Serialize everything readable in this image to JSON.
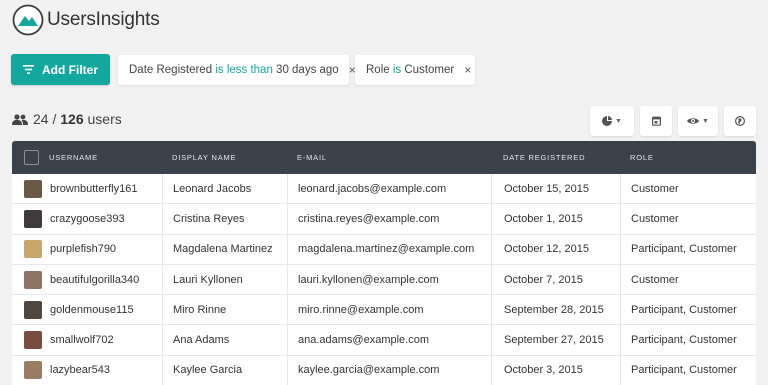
{
  "brand": {
    "name": "UsersInsights",
    "colors": {
      "accent": "#14a79d",
      "header": "#3b424b"
    }
  },
  "toolbar": {
    "add_filter_label": "Add Filter"
  },
  "filters": [
    {
      "field": "Date Registered",
      "operator": "is less than",
      "value": "30 days ago"
    },
    {
      "field": "Role",
      "operator": "is",
      "value": "Customer"
    }
  ],
  "filter_remove_glyph": "×",
  "summary": {
    "filtered": "24",
    "separator": " / ",
    "total": "126",
    "unit": " users"
  },
  "view_buttons": [
    {
      "icon": "pie-chart-icon",
      "has_dropdown": true
    },
    {
      "icon": "calendar-icon",
      "has_dropdown": false
    },
    {
      "icon": "eye-icon",
      "has_dropdown": true
    },
    {
      "icon": "globe-icon",
      "has_dropdown": false
    }
  ],
  "table": {
    "columns": [
      "Username",
      "Display Name",
      "E-mail",
      "Date Registered",
      "Role"
    ],
    "rows": [
      {
        "username": "brownbutterfly161",
        "display_name": "Leonard Jacobs",
        "email": "leonard.jacobs@example.com",
        "date": "October 15, 2015",
        "role": "Customer",
        "avatar_color": "#6b5845"
      },
      {
        "username": "crazygoose393",
        "display_name": "Cristina Reyes",
        "email": "cristina.reyes@example.com",
        "date": "October 1, 2015",
        "role": "Customer",
        "avatar_color": "#3d3a39"
      },
      {
        "username": "purplefish790",
        "display_name": "Magdalena Martinez",
        "email": "magdalena.martinez@example.com",
        "date": "October 12, 2015",
        "role": "Participant, Customer",
        "avatar_color": "#c9a66b"
      },
      {
        "username": "beautifulgorilla340",
        "display_name": "Lauri Kyllonen",
        "email": "lauri.kyllonen@example.com",
        "date": "October 7, 2015",
        "role": "Customer",
        "avatar_color": "#8f7466"
      },
      {
        "username": "goldenmouse115",
        "display_name": "Miro Rinne",
        "email": "miro.rinne@example.com",
        "date": "September 28, 2015",
        "role": "Participant, Customer",
        "avatar_color": "#4f4640"
      },
      {
        "username": "smallwolf702",
        "display_name": "Ana Adams",
        "email": "ana.adams@example.com",
        "date": "September 27, 2015",
        "role": "Participant, Customer",
        "avatar_color": "#7a4c3e"
      },
      {
        "username": "lazybear543",
        "display_name": "Kaylee Garcia",
        "email": "kaylee.garcia@example.com",
        "date": "October 3, 2015",
        "role": "Participant, Customer",
        "avatar_color": "#9a7c62"
      }
    ]
  }
}
